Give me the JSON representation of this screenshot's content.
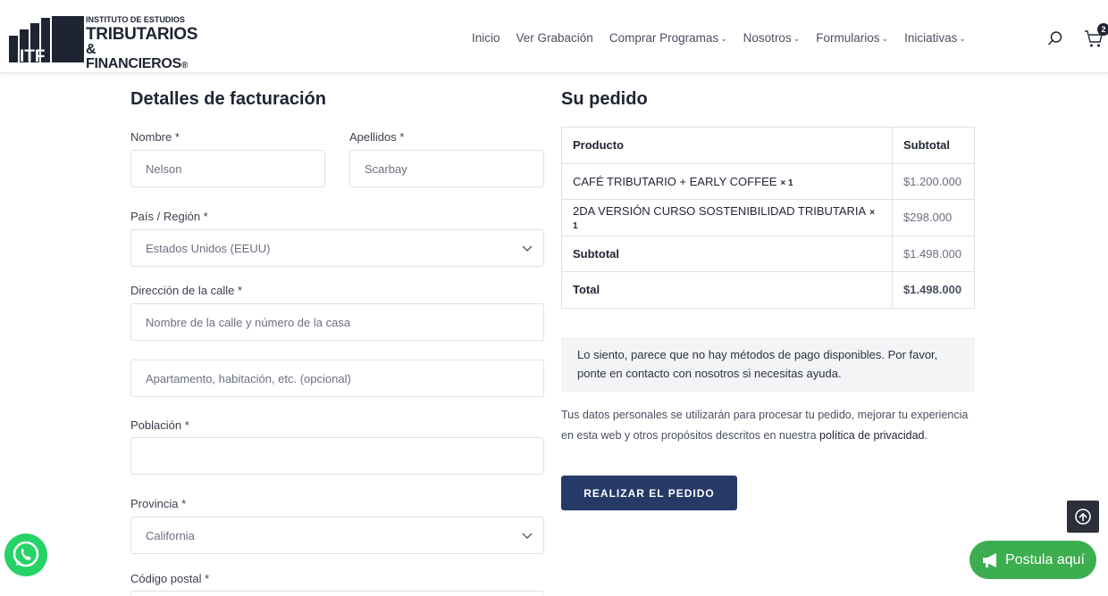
{
  "logo": {
    "line1": "INSTITUTO DE ESTUDIOS",
    "line2": "TRIBUTARIOS",
    "line3": "& FINANCIEROS",
    "registered": "®",
    "mark_text": "ITF"
  },
  "nav": {
    "items": [
      {
        "label": "Inicio",
        "has_dropdown": false
      },
      {
        "label": "Ver Grabación",
        "has_dropdown": false
      },
      {
        "label": "Comprar Programas",
        "has_dropdown": true
      },
      {
        "label": "Nosotros",
        "has_dropdown": true
      },
      {
        "label": "Formularios",
        "has_dropdown": true
      },
      {
        "label": "Iniciativas",
        "has_dropdown": true
      }
    ],
    "cart_count": "2"
  },
  "billing": {
    "title": "Detalles de facturación",
    "nombre_label": "Nombre *",
    "nombre_value": "Nelson",
    "apellidos_label": "Apellidos *",
    "apellidos_value": "Scarbay",
    "pais_label": "País / Región *",
    "pais_value": "Estados Unidos (EEUU)",
    "direccion_label": "Dirección de la calle *",
    "direccion_placeholder": "Nombre de la calle y número de la casa",
    "apartamento_placeholder": "Apartamento, habitación, etc. (opcional)",
    "poblacion_label": "Población *",
    "poblacion_value": "",
    "provincia_label": "Provincia *",
    "provincia_value": "California",
    "postal_label": "Código postal *"
  },
  "order": {
    "title": "Su pedido",
    "col_product": "Producto",
    "col_subtotal": "Subtotal",
    "items": [
      {
        "name": "CAFÉ TRIBUTARIO + EARLY COFFEE",
        "qty": "× 1",
        "price": "$1.200.000"
      },
      {
        "name": "2DA VERSIÓN CURSO SOSTENIBILIDAD TRIBUTARIA",
        "qty": "× 1",
        "price": "$298.000"
      }
    ],
    "subtotal_label": "Subtotal",
    "subtotal_value": "$1.498.000",
    "total_label": "Total",
    "total_value": "$1.498.000",
    "notice": "Lo siento, parece que no hay métodos de pago disponibles. Por favor, ponte en contacto con nosotros si necesitas ayuda.",
    "privacy_text": "Tus datos personales se utilizarán para procesar tu pedido, mejorar tu experiencia en esta web y otros propósitos descritos en nuestra ",
    "privacy_link": "política de privacidad",
    "privacy_end": ".",
    "place_order": "REALIZAR EL PEDIDO"
  },
  "floating": {
    "postula_label": "Postula aquí"
  },
  "colors": {
    "primary": "#263a67",
    "text": "#1f2433",
    "whatsapp": "#25d366",
    "postula": "#3cae50",
    "notice_bg": "#f3f4f6"
  },
  "icons": {
    "search": "search-icon",
    "cart": "cart-icon",
    "chevron": "chevron-down-icon",
    "whatsapp": "whatsapp-icon",
    "scroll_top": "arrow-up-circle-icon",
    "megaphone": "megaphone-icon"
  }
}
